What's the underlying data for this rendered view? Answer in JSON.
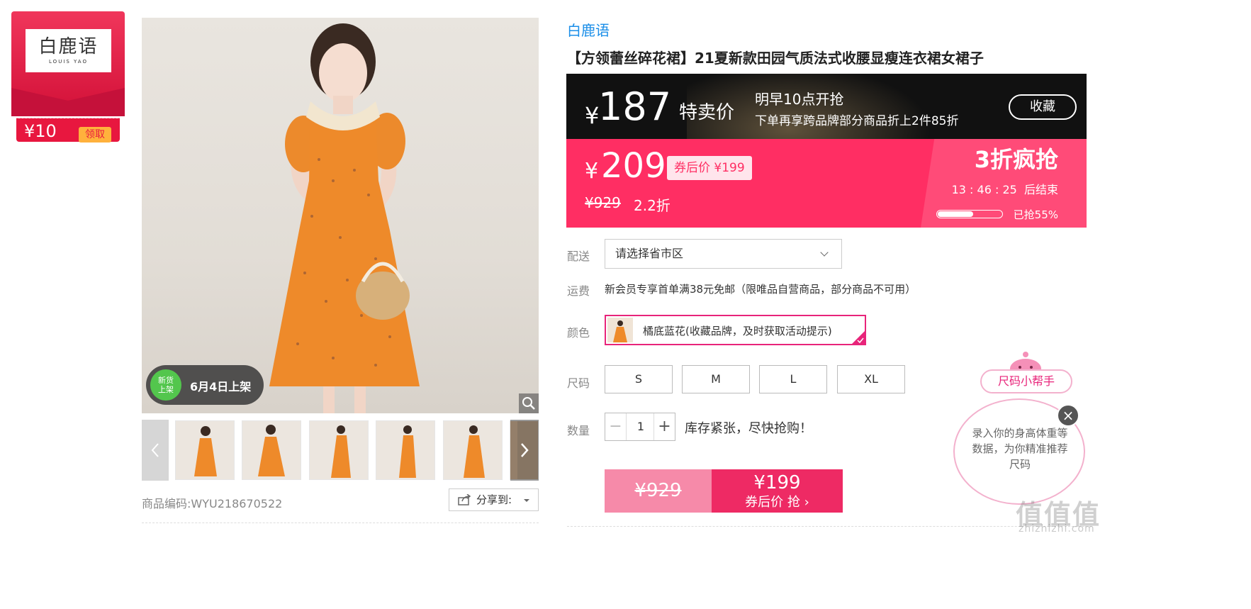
{
  "brand_card": {
    "logo_cn": "白鹿语",
    "logo_en": "LOUIS YAO",
    "coupon_value": "¥10",
    "claim_label": "领取"
  },
  "gallery": {
    "new_badge_circle": "新货\n上架",
    "new_badge_text": "6月4日上架",
    "thumbnail_count": 6
  },
  "sku": {
    "label": "商品编码:",
    "code": "WYU218670522"
  },
  "share": {
    "label": "分享到:"
  },
  "product": {
    "brand": "白鹿语",
    "title": "【方领蕾丝碎花裙】21夏新款田园气质法式收腰显瘦连衣裙女裙子"
  },
  "special_banner": {
    "currency": "¥",
    "price": "187",
    "price_tag": "特卖价",
    "line1": "明早10点开抢",
    "line2": "下单再享跨品牌部分商品折上2件85折",
    "fav_label": "收藏"
  },
  "sale_banner": {
    "currency": "¥",
    "price": "209",
    "coupon_price": "券后价 ¥199",
    "original_price": "¥929",
    "discount": "2.2折",
    "promo": "3折疯抢",
    "countdown": "13 : 46 : 25",
    "countdown_suffix": "后结束",
    "sold_label": "已抢55%",
    "sold_fraction": 0.55
  },
  "delivery": {
    "label": "配送",
    "placeholder": "请选择省市区"
  },
  "shipping": {
    "label": "运费",
    "text": "新会员专享首单满38元免邮（限唯品自营商品，部分商品不可用）"
  },
  "color": {
    "label": "颜色",
    "option": "橘底蓝花(收藏品牌，及时获取活动提示)"
  },
  "size": {
    "label": "尺码",
    "options": [
      "S",
      "M",
      "L",
      "XL"
    ]
  },
  "quantity": {
    "label": "数量",
    "minus": "−",
    "value": "1",
    "plus": "+",
    "stock_text": "库存紧张，尽快抢购！"
  },
  "buy": {
    "original": "¥929",
    "price": "¥199",
    "subtitle": "券后价 抢 ›"
  },
  "size_helper": {
    "label": "尺码小帮手",
    "bubble_text": "录入你的身高体重等数据，为你精准推荐尺码",
    "close": "×"
  },
  "watermark": {
    "text": "值值值",
    "url": "zhizhizhi.com"
  },
  "colors": {
    "accent_pink": "#ff2e63",
    "brand_blue": "#1a8ee8",
    "magenta": "#e8247a"
  }
}
